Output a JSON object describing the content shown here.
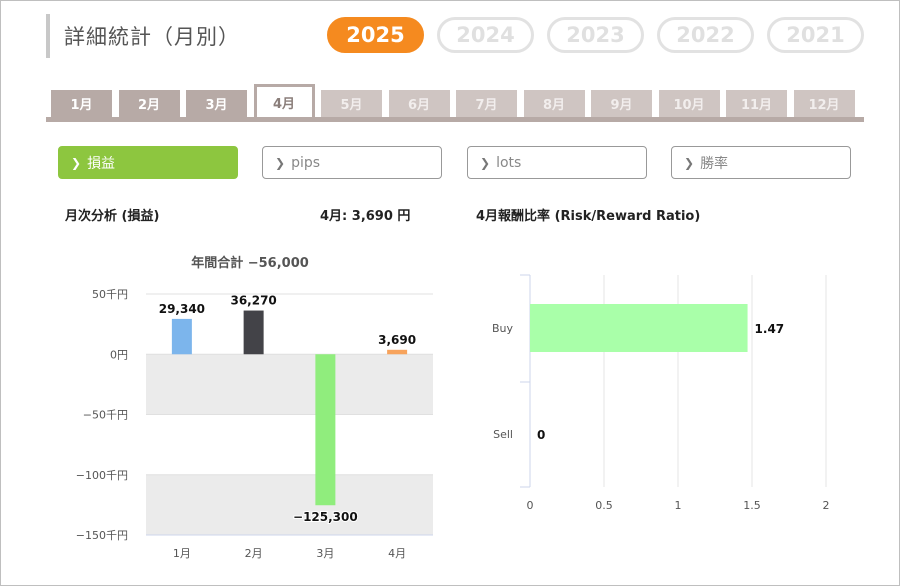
{
  "page": {
    "title": "詳細統計（月別）"
  },
  "years": [
    {
      "label": "2025",
      "active": true
    },
    {
      "label": "2024",
      "active": false
    },
    {
      "label": "2023",
      "active": false
    },
    {
      "label": "2022",
      "active": false
    },
    {
      "label": "2021",
      "active": false
    }
  ],
  "months": [
    {
      "label": "1月",
      "state": "enabled"
    },
    {
      "label": "2月",
      "state": "enabled"
    },
    {
      "label": "3月",
      "state": "enabled"
    },
    {
      "label": "4月",
      "state": "active"
    },
    {
      "label": "5月",
      "state": "disabled"
    },
    {
      "label": "6月",
      "state": "disabled"
    },
    {
      "label": "7月",
      "state": "disabled"
    },
    {
      "label": "8月",
      "state": "disabled"
    },
    {
      "label": "9月",
      "state": "disabled"
    },
    {
      "label": "10月",
      "state": "disabled"
    },
    {
      "label": "11月",
      "state": "disabled"
    },
    {
      "label": "12月",
      "state": "disabled"
    }
  ],
  "metrics": [
    {
      "label": "損益",
      "active": true
    },
    {
      "label": "pips",
      "active": false
    },
    {
      "label": "lots",
      "active": false
    },
    {
      "label": "勝率",
      "active": false
    }
  ],
  "left_panel": {
    "title": "月次分析 (損益)",
    "summary": "4月:  3,690 円"
  },
  "right_panel": {
    "title": "4月報酬比率 (Risk/Reward Ratio)"
  },
  "colors": {
    "accent_orange": "#f58a1f",
    "accent_green": "#8dc63f",
    "tab_gray": "#b7aaa6"
  },
  "chart_data": [
    {
      "type": "bar",
      "title": "年間合計 −56,000",
      "categories": [
        "1月",
        "2月",
        "3月",
        "4月"
      ],
      "values": [
        29340,
        36270,
        -125300,
        3690
      ],
      "labels": [
        "29,340",
        "36,270",
        "−125,300",
        "3,690"
      ],
      "colors": [
        "#7cb5ec",
        "#434348",
        "#90ed7d",
        "#f7a35c"
      ],
      "ylim": [
        -150000,
        50000
      ],
      "yticks": [
        50000,
        0,
        -50000,
        -100000,
        -150000
      ],
      "ytick_labels": [
        "50千円",
        "0円",
        "−50千円",
        "−100千円",
        "−150千円"
      ],
      "alternating_bands": true
    },
    {
      "type": "bar",
      "orientation": "horizontal",
      "categories": [
        "Buy",
        "Sell"
      ],
      "values": [
        1.47,
        0
      ],
      "labels": [
        "1.47",
        "0"
      ],
      "color": "#a9ffa9",
      "xlim": [
        0,
        2
      ],
      "xticks": [
        0,
        0.5,
        1,
        1.5,
        2
      ],
      "xtick_labels": [
        "0",
        "0.5",
        "1",
        "1.5",
        "2"
      ],
      "grid": true
    }
  ]
}
